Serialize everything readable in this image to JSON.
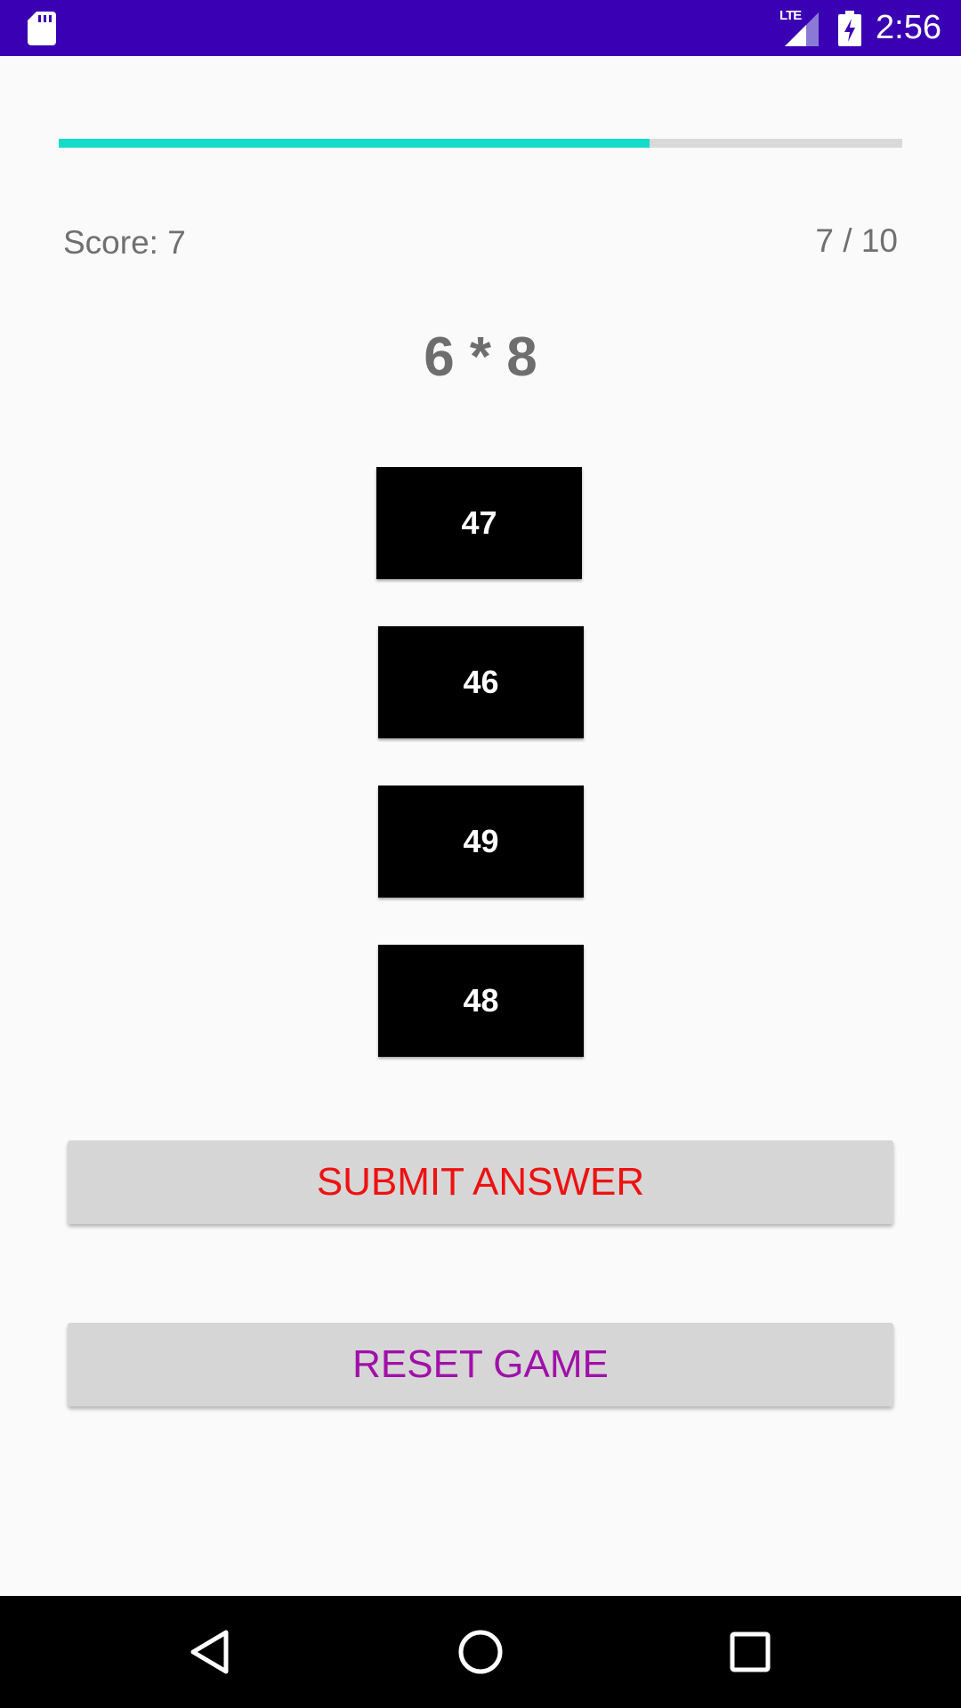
{
  "status_bar": {
    "network_label": "LTE",
    "time": "2:56",
    "icons": [
      "sd-card-icon",
      "signal-icon",
      "battery-charging-icon"
    ],
    "background": "#3a00b3"
  },
  "game": {
    "progress": 0.7,
    "progress_color": "#14dcc8",
    "score_text": "Score: 7",
    "counter_text": "7 / 10",
    "question": "6 * 8",
    "choices": [
      "47",
      "46",
      "49",
      "48"
    ],
    "submit_label": "SUBMIT ANSWER",
    "submit_color": "#ee1111",
    "reset_label": "RESET GAME",
    "reset_color": "#a010a8"
  },
  "nav_bar": {
    "icons": [
      "back-icon",
      "home-icon",
      "recents-icon"
    ]
  }
}
